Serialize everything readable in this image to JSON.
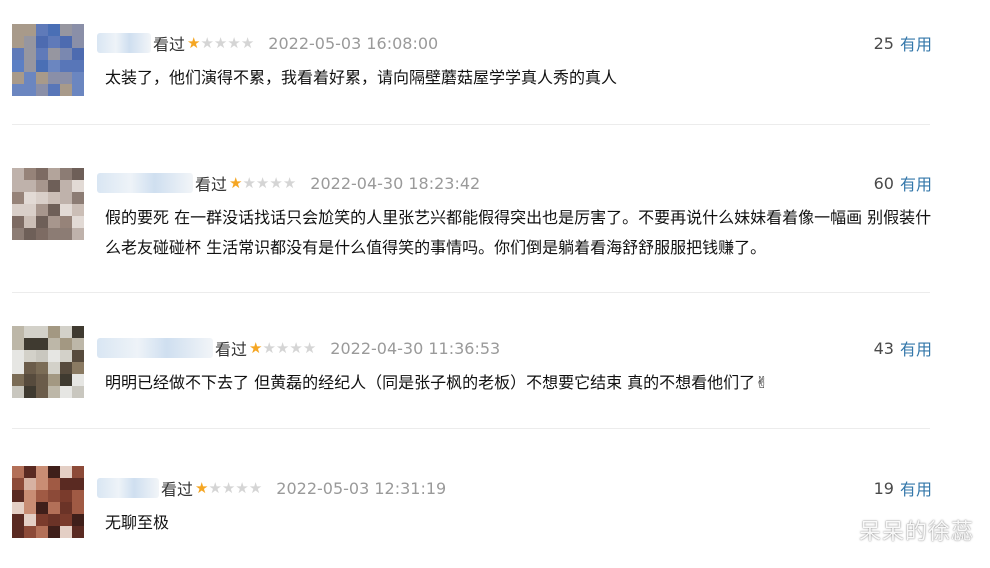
{
  "comments": [
    {
      "status": "看过",
      "rating": 1,
      "max_rating": 5,
      "time": "2022-05-03 16:08:00",
      "useful_count": "25",
      "useful_label": "有用",
      "content": "太装了，他们演得不累，我看着好累，请向隔壁蘑菇屋学学真人秀的真人"
    },
    {
      "status": "看过",
      "rating": 1,
      "max_rating": 5,
      "time": "2022-04-30 18:23:42",
      "useful_count": "60",
      "useful_label": "有用",
      "content": "假的要死 在一群没话找话只会尬笑的人里张艺兴都能假得突出也是厉害了。不要再说什么妹妹看着像一幅画 别假装什么老友碰碰杯 生活常识都没有是什么值得笑的事情吗。你们倒是躺着看海舒舒服服把钱赚了。"
    },
    {
      "status": "看过",
      "rating": 1,
      "max_rating": 5,
      "time": "2022-04-30 11:36:53",
      "useful_count": "43",
      "useful_label": "有用",
      "content": "明明已经做不下去了 但黄磊的经纪人（同是张子枫的老板）不想要它结束 真的不想看他们了✌"
    },
    {
      "status": "看过",
      "rating": 1,
      "max_rating": 5,
      "time": "2022-05-03 12:31:19",
      "useful_count": "19",
      "useful_label": "有用",
      "content": "无聊至极"
    }
  ],
  "watermark": "呆呆的徐蕊",
  "colors": {
    "accent_link": "#3377aa",
    "star_on": "#f5a623",
    "star_off": "#d5d5d5",
    "timestamp": "#9a9a9a"
  }
}
